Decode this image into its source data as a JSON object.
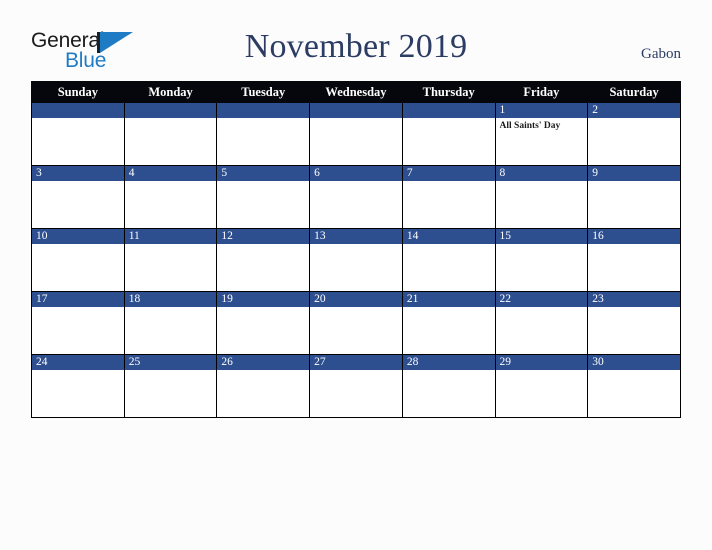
{
  "brand": {
    "name_part1": "General",
    "name_part2": "Blue",
    "mark_icon": "triangle-logo-icon"
  },
  "header": {
    "title": "November 2019",
    "locale": "Gabon"
  },
  "colors": {
    "page_background": "#fcfcfd",
    "title_text": "#2c3c63",
    "weekday_header_background": "#05070c",
    "weekday_header_text": "#ffffff",
    "day_number_bar": "#2e4f8f",
    "day_number_text": "#ffffff",
    "cell_background": "#ffffff",
    "cell_border": "#000000",
    "brand_blue": "#1f7cc4",
    "brand_dark": "#1b1b1b",
    "event_text": "#1b1b1b"
  },
  "calendar": {
    "weekdays": [
      "Sunday",
      "Monday",
      "Tuesday",
      "Wednesday",
      "Thursday",
      "Friday",
      "Saturday"
    ],
    "weeks": [
      [
        {
          "day": "",
          "events": []
        },
        {
          "day": "",
          "events": []
        },
        {
          "day": "",
          "events": []
        },
        {
          "day": "",
          "events": []
        },
        {
          "day": "",
          "events": []
        },
        {
          "day": "1",
          "events": [
            "All Saints' Day"
          ]
        },
        {
          "day": "2",
          "events": []
        }
      ],
      [
        {
          "day": "3",
          "events": []
        },
        {
          "day": "4",
          "events": []
        },
        {
          "day": "5",
          "events": []
        },
        {
          "day": "6",
          "events": []
        },
        {
          "day": "7",
          "events": []
        },
        {
          "day": "8",
          "events": []
        },
        {
          "day": "9",
          "events": []
        }
      ],
      [
        {
          "day": "10",
          "events": []
        },
        {
          "day": "11",
          "events": []
        },
        {
          "day": "12",
          "events": []
        },
        {
          "day": "13",
          "events": []
        },
        {
          "day": "14",
          "events": []
        },
        {
          "day": "15",
          "events": []
        },
        {
          "day": "16",
          "events": []
        }
      ],
      [
        {
          "day": "17",
          "events": []
        },
        {
          "day": "18",
          "events": []
        },
        {
          "day": "19",
          "events": []
        },
        {
          "day": "20",
          "events": []
        },
        {
          "day": "21",
          "events": []
        },
        {
          "day": "22",
          "events": []
        },
        {
          "day": "23",
          "events": []
        }
      ],
      [
        {
          "day": "24",
          "events": []
        },
        {
          "day": "25",
          "events": []
        },
        {
          "day": "26",
          "events": []
        },
        {
          "day": "27",
          "events": []
        },
        {
          "day": "28",
          "events": []
        },
        {
          "day": "29",
          "events": []
        },
        {
          "day": "30",
          "events": []
        }
      ]
    ]
  }
}
